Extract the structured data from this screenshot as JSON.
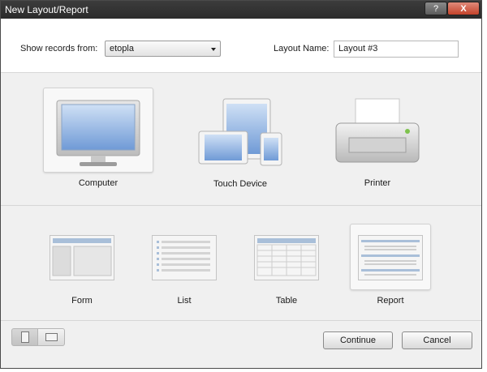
{
  "window": {
    "title": "New Layout/Report",
    "help_glyph": "?",
    "close_glyph": "X"
  },
  "form": {
    "records_label": "Show records from:",
    "records_value": "etopla",
    "layout_name_label": "Layout Name:",
    "layout_name_value": "Layout #3"
  },
  "devices": [
    {
      "label": "Computer",
      "selected": true
    },
    {
      "label": "Touch Device",
      "selected": false
    },
    {
      "label": "Printer",
      "selected": false
    }
  ],
  "layouts": [
    {
      "label": "Form",
      "selected": false
    },
    {
      "label": "List",
      "selected": false
    },
    {
      "label": "Table",
      "selected": false
    },
    {
      "label": "Report",
      "selected": true
    }
  ],
  "buttons": {
    "continue": "Continue",
    "cancel": "Cancel"
  },
  "colors": {
    "screen_blue": "#7fa9dd",
    "accent_header": "#a9bfd9",
    "selection_border": "#d2d2d2"
  },
  "icons": [
    "computer-icon",
    "touch-device-icon",
    "printer-icon",
    "form-layout-icon",
    "list-layout-icon",
    "table-layout-icon",
    "report-layout-icon",
    "portrait-icon",
    "landscape-icon"
  ]
}
